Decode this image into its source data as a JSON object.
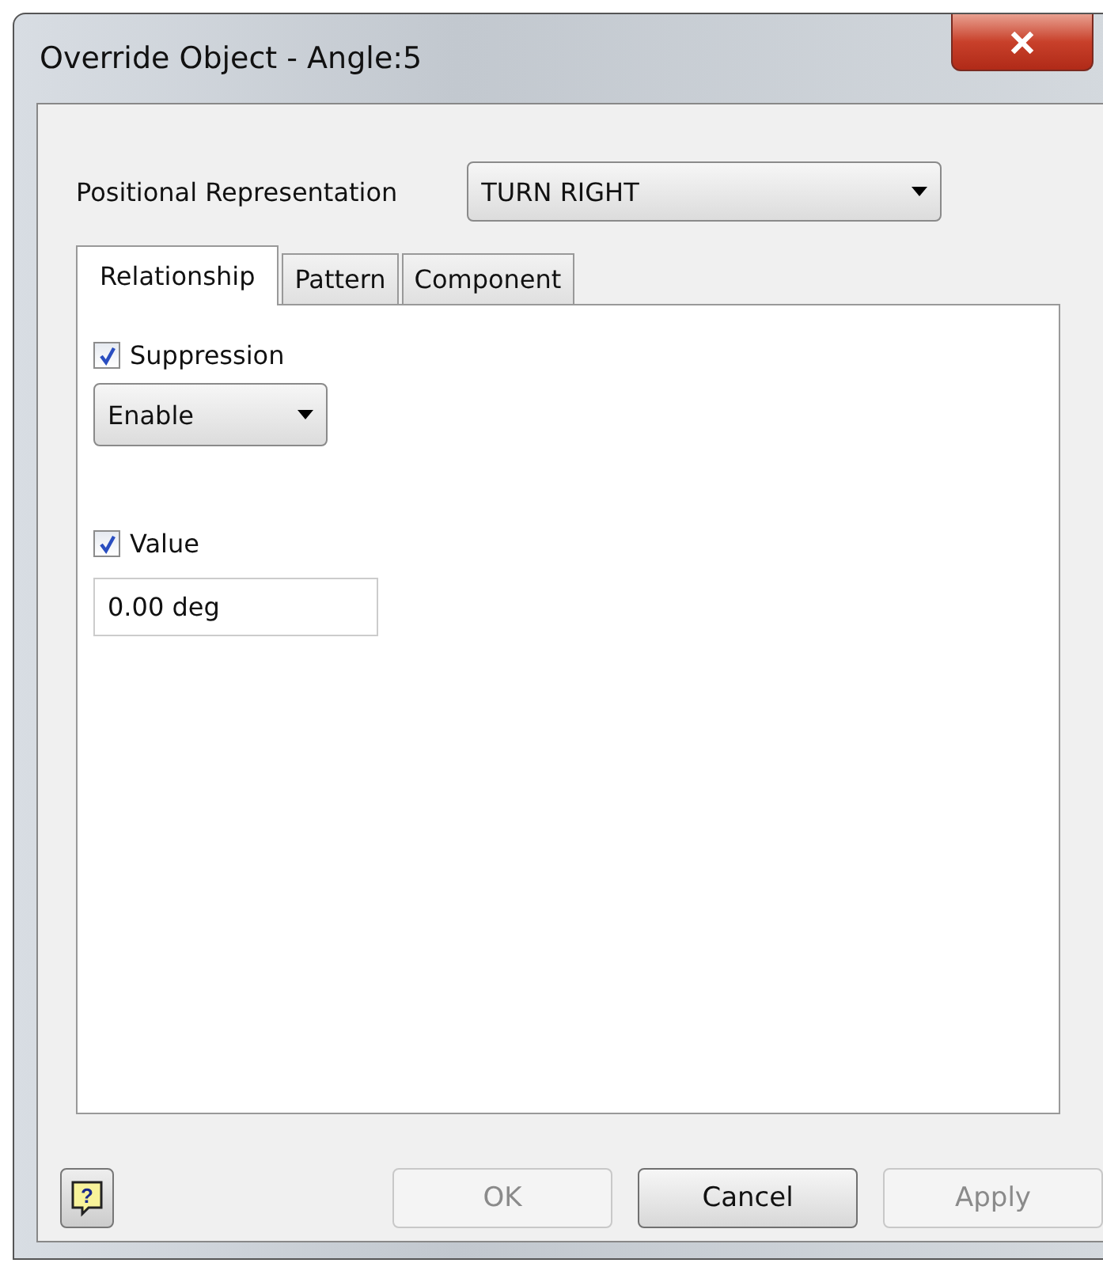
{
  "window": {
    "title": "Override Object - Angle:5"
  },
  "positional_representation": {
    "label": "Positional Representation",
    "value": "TURN RIGHT"
  },
  "tabs": [
    {
      "label": "Relationship",
      "selected": true
    },
    {
      "label": "Pattern",
      "selected": false
    },
    {
      "label": "Component",
      "selected": false
    }
  ],
  "suppression": {
    "label": "Suppression",
    "checked": true,
    "value": "Enable"
  },
  "value": {
    "label": "Value",
    "checked": true,
    "value": "0.00 deg"
  },
  "help": {
    "label": "?"
  },
  "buttons": [
    {
      "label": "OK",
      "disabled": true
    },
    {
      "label": "Cancel",
      "disabled": false
    },
    {
      "label": "Apply",
      "disabled": true
    }
  ]
}
